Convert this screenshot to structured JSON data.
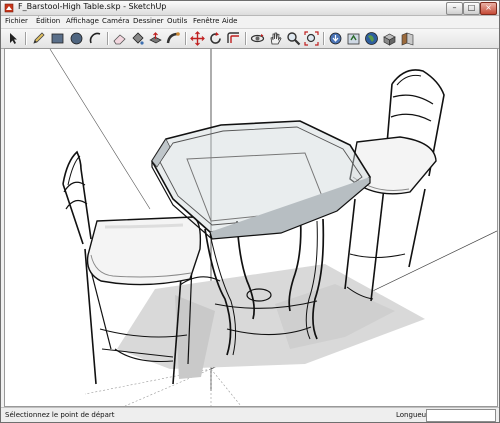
{
  "window": {
    "title": "F_Barstool-High Table.skp - SketchUp"
  },
  "menu": {
    "items": [
      "Fichier",
      "Édition",
      "Affichage",
      "Caméra",
      "Dessiner",
      "Outils",
      "Fenêtre",
      "Aide"
    ]
  },
  "toolbar": {
    "tools": [
      "select-arrow-icon",
      "pencil-line-icon",
      "rectangle-icon",
      "circle-icon",
      "arc-icon",
      "eraser-icon",
      "paint-bucket-icon",
      "push-pull-icon",
      "follow-me-icon",
      "move-icon",
      "rotate-icon",
      "offset-icon",
      "orbit-icon",
      "pan-hand-icon",
      "zoom-icon",
      "zoom-extents-icon",
      "get-models-icon",
      "share-model-icon",
      "google-earth-icon",
      "components-icon",
      "materials-icon"
    ]
  },
  "status": {
    "message": "Sélectionnez le point de départ",
    "measure_label": "Longueur",
    "measure_value": ""
  }
}
